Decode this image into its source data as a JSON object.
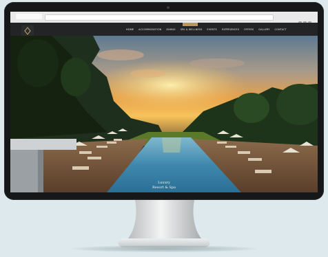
{
  "browser": {
    "tab_icon": "tab-icon",
    "window_controls": [
      "minimize-icon",
      "maximize-icon",
      "close-icon"
    ]
  },
  "site": {
    "logo_icon": "resort-logo-icon",
    "nav": [
      {
        "label": "Home",
        "active": true
      },
      {
        "label": "Accommodation"
      },
      {
        "label": "Dining"
      },
      {
        "label": "Spa & Wellness"
      },
      {
        "label": "Events"
      },
      {
        "label": "Experiences"
      },
      {
        "label": "Offers"
      },
      {
        "label": "Gallery"
      },
      {
        "label": "Contact"
      }
    ],
    "hero": {
      "caption_line1": "Luxury",
      "caption_line2": "Resort & Spa"
    }
  },
  "colors": {
    "background": "#dde9ec",
    "bezel": "#161718",
    "header": "#222426",
    "accent": "#b89a56"
  }
}
